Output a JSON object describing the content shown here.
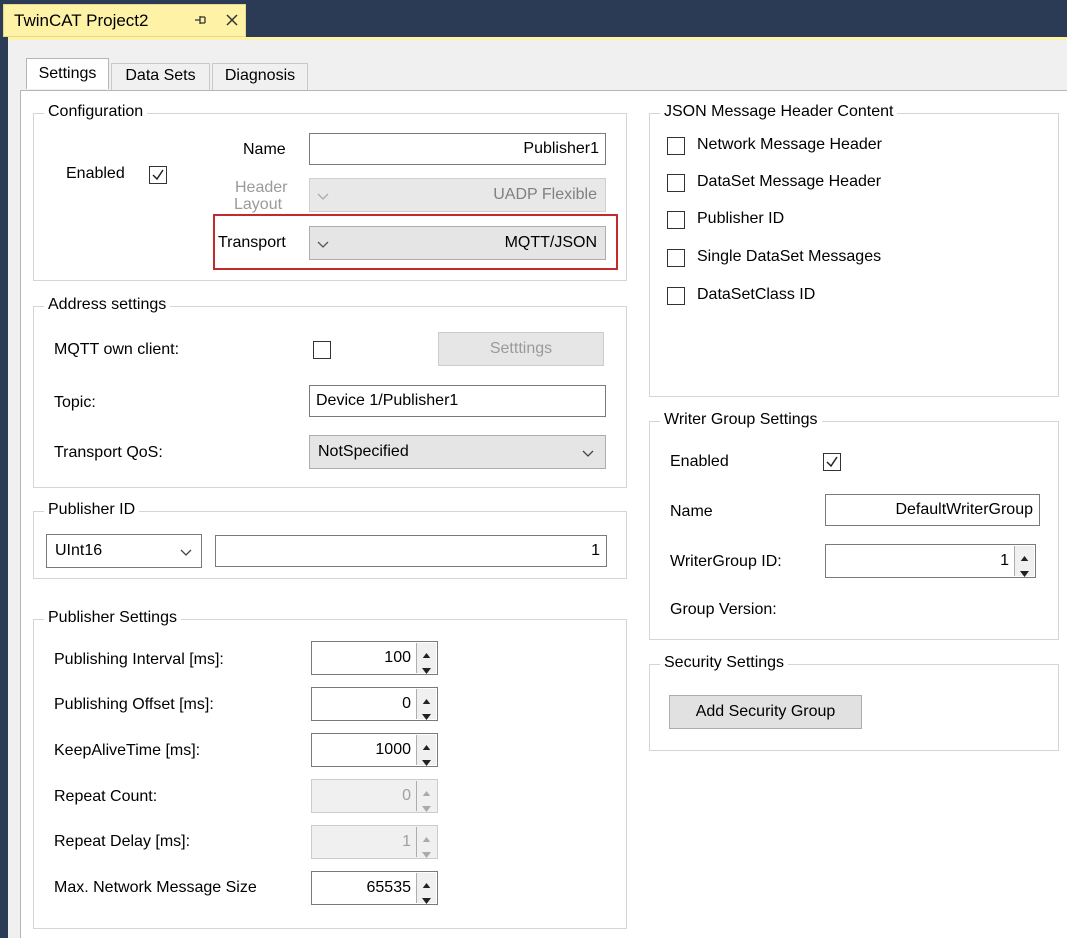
{
  "document_tab": {
    "title": "TwinCAT Project2"
  },
  "tabs": [
    {
      "label": "Settings"
    },
    {
      "label": "Data Sets"
    },
    {
      "label": "Diagnosis"
    }
  ],
  "configuration": {
    "title": "Configuration",
    "enabled_label": "Enabled",
    "enabled_checked": true,
    "name_label": "Name",
    "name_value": "Publisher1",
    "header_layout_label_line1": "Header",
    "header_layout_label_line2": "Layout",
    "header_layout_value": "UADP Flexible",
    "transport_label": "Transport",
    "transport_value": "MQTT/JSON"
  },
  "address": {
    "title": "Address settings",
    "own_client_label": "MQTT own client:",
    "own_client_checked": false,
    "settings_button": "Setttings",
    "topic_label": "Topic:",
    "topic_value": "Device 1/Publisher1",
    "qos_label": "Transport QoS:",
    "qos_value": "NotSpecified"
  },
  "publisher_id": {
    "title": "Publisher ID",
    "type_value": "UInt16",
    "id_value": "1"
  },
  "publisher_settings": {
    "title": "Publisher Settings",
    "rows": [
      {
        "label": "Publishing Interval [ms]:",
        "value": "100",
        "disabled": false
      },
      {
        "label": "Publishing Offset [ms]:",
        "value": "0",
        "disabled": false
      },
      {
        "label": "KeepAliveTime [ms]:",
        "value": "1000",
        "disabled": false
      },
      {
        "label": "Repeat Count:",
        "value": "0",
        "disabled": true
      },
      {
        "label": "Repeat Delay [ms]:",
        "value": "1",
        "disabled": true
      },
      {
        "label": "Max. Network Message Size",
        "value": "65535",
        "disabled": false
      }
    ]
  },
  "json_header": {
    "title": "JSON Message Header Content",
    "items": [
      {
        "label": "Network Message Header",
        "checked": false
      },
      {
        "label": "DataSet Message Header",
        "checked": false
      },
      {
        "label": "Publisher ID",
        "checked": false
      },
      {
        "label": "Single DataSet Messages",
        "checked": false
      },
      {
        "label": "DataSetClass ID",
        "checked": false
      }
    ]
  },
  "writer_group": {
    "title": "Writer Group Settings",
    "enabled_label": "Enabled",
    "enabled_checked": true,
    "name_label": "Name",
    "name_value": "DefaultWriterGroup",
    "id_label": "WriterGroup ID:",
    "id_value": "1",
    "version_label": "Group Version:"
  },
  "security": {
    "title": "Security Settings",
    "add_button": "Add Security Group"
  },
  "colors": {
    "chrome": "#2b3a55",
    "active_doc_tab": "#fdf2a6",
    "highlight": "#c22b2b"
  }
}
